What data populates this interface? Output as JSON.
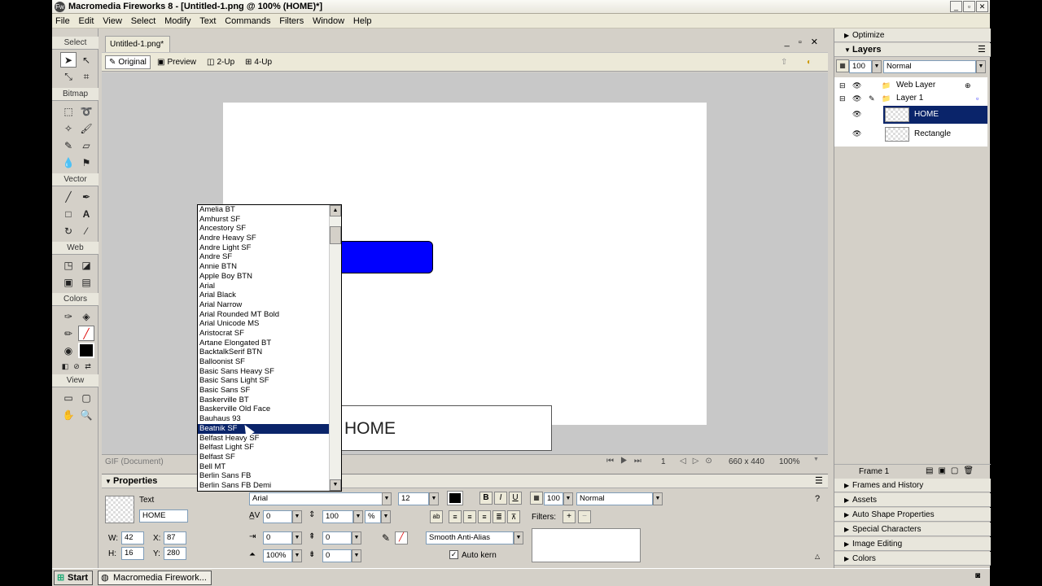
{
  "window": {
    "title": "Macromedia Fireworks 8 - [Untitled-1.png @ 100% (HOME)*]",
    "app_icon": "Fw",
    "controls": [
      "_",
      "▫",
      "✕"
    ]
  },
  "menu": [
    "File",
    "Edit",
    "View",
    "Select",
    "Modify",
    "Text",
    "Commands",
    "Filters",
    "Window",
    "Help"
  ],
  "tools": {
    "sections": [
      "Select",
      "Bitmap",
      "Vector",
      "Web",
      "Colors",
      "View"
    ]
  },
  "document": {
    "tab": "Untitled-1.png*",
    "views": [
      "Original",
      "Preview",
      "2-Up",
      "4-Up"
    ],
    "canvas_text": "HOME",
    "status_left": "GIF (Document)",
    "frame": "1",
    "size": "660 x 440",
    "zoom": "100%"
  },
  "fontlist": {
    "items": [
      "Amelia BT",
      "Amhurst SF",
      "Ancestory SF",
      "Andre Heavy SF",
      "Andre Light SF",
      "Andre SF",
      "Annie BTN",
      "Apple Boy BTN",
      "Arial",
      "Arial Black",
      "Arial Narrow",
      "Arial Rounded MT Bold",
      "Arial Unicode MS",
      "Aristocrat SF",
      "Artane Elongated BT",
      "BacktalkSerif BTN",
      "Balloonist SF",
      "Basic Sans Heavy SF",
      "Basic Sans Light SF",
      "Basic Sans SF",
      "Baskerville BT",
      "Baskerville Old Face",
      "Bauhaus 93",
      "Beatnik SF",
      "Belfast Heavy SF",
      "Belfast Light SF",
      "Belfast SF",
      "Bell MT",
      "Berlin Sans FB",
      "Berlin Sans FB Demi"
    ],
    "selected_index": 23
  },
  "properties": {
    "header": "Properties",
    "type": "Text",
    "name": "HOME",
    "font": "Arial",
    "size": "12",
    "opacity": "100",
    "blend": "Normal",
    "kerning": "0",
    "leading": "100",
    "leading_unit": "%",
    "indent": "0",
    "space_before": "0",
    "space_after": "0",
    "paragraph_indent": "0",
    "horizontal_scale": "100%",
    "baseline_shift": "0",
    "antialias": "Smooth Anti-Alias",
    "autokern": "Auto kern",
    "filters_label": "Filters:",
    "w_label": "W:",
    "w": "42",
    "h_label": "H:",
    "h": "16",
    "x_label": "X:",
    "x": "87",
    "y_label": "Y:",
    "y": "280",
    "bold": "B",
    "italic": "I",
    "underline": "U"
  },
  "panels": {
    "optimize": "Optimize",
    "layers": "Layers",
    "layers_opacity": "100",
    "layers_blend": "Normal",
    "layer_rows": [
      {
        "name": "Web Layer"
      },
      {
        "name": "Layer 1"
      },
      {
        "name": "HOME"
      },
      {
        "name": "Rectangle"
      }
    ],
    "frame_label": "Frame 1",
    "collapsed": [
      "Frames and History",
      "Assets",
      "Auto Shape Properties",
      "Special Characters",
      "Image Editing",
      "Colors"
    ]
  },
  "taskbar": {
    "start": "Start",
    "item": "Macromedia Firework..."
  },
  "colors": {
    "selection": "#0a246a",
    "button_fill": "#0000ff"
  }
}
